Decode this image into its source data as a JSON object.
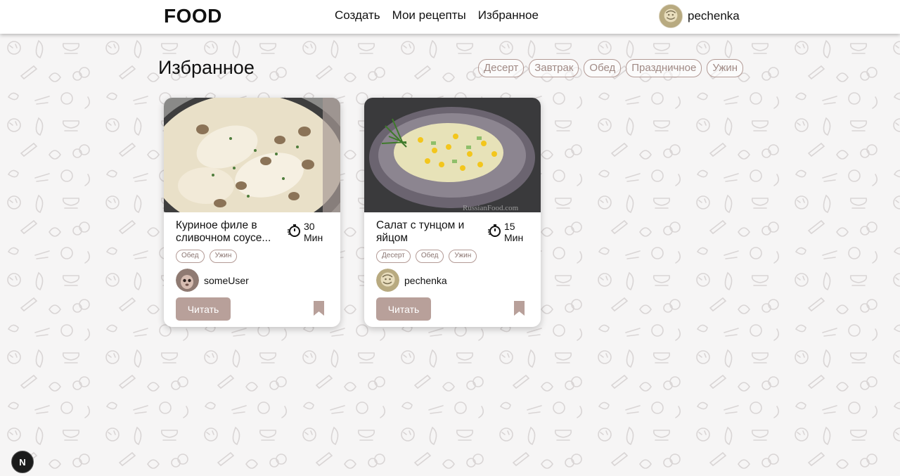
{
  "app": {
    "logo": "FOOD"
  },
  "nav": {
    "items": [
      "Создать",
      "Мои рецепты",
      "Избранное"
    ]
  },
  "user": {
    "name": "pechenka"
  },
  "page": {
    "title": "Избранное"
  },
  "filters": [
    "Десерт",
    "Завтрак",
    "Обед",
    "Праздничное",
    "Ужин"
  ],
  "recipes": [
    {
      "title": "Куриное филе в сливочном соусе...",
      "time_value": "30",
      "time_unit": "Мин",
      "tags": [
        "Обед",
        "Ужин"
      ],
      "author": "someUser",
      "read_label": "Читать"
    },
    {
      "title": "Салат с тунцом и яйцом",
      "time_value": "15",
      "time_unit": "Мин",
      "tags": [
        "Десерт",
        "Обед",
        "Ужин"
      ],
      "author": "pechenka",
      "read_label": "Читать"
    }
  ],
  "dev_badge": {
    "label": "N"
  },
  "colors": {
    "accent": "#b8a09a",
    "chip_border": "#b39a95"
  }
}
